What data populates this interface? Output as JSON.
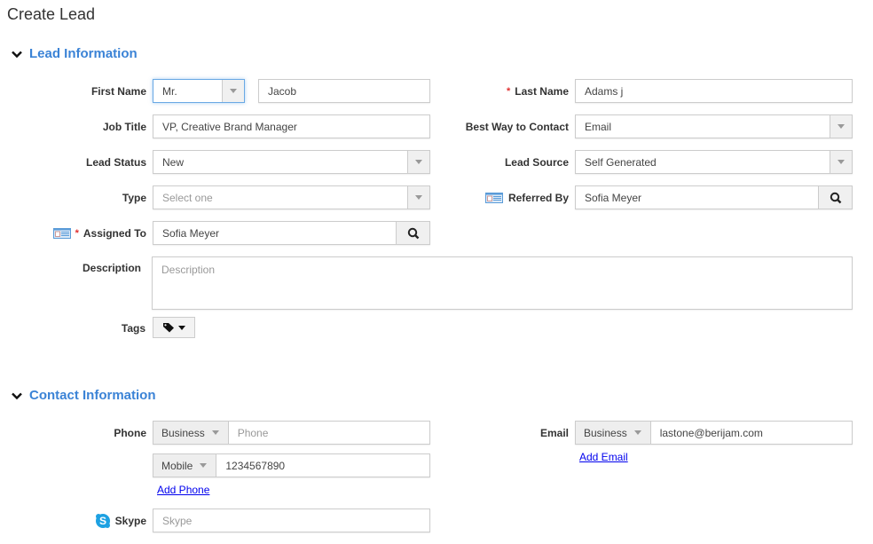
{
  "page": {
    "title": "Create Lead"
  },
  "sections": {
    "lead_info": {
      "title": "Lead Information",
      "fields": {
        "first_name": {
          "label": "First Name",
          "salutation": "Mr.",
          "value": "Jacob"
        },
        "last_name": {
          "label": "Last Name",
          "required_mark": "*",
          "value": "Adams j"
        },
        "job_title": {
          "label": "Job Title",
          "value": "VP, Creative Brand Manager"
        },
        "best_way": {
          "label": "Best Way to Contact",
          "value": "Email"
        },
        "lead_status": {
          "label": "Lead Status",
          "value": "New"
        },
        "lead_source": {
          "label": "Lead Source",
          "value": "Self Generated"
        },
        "type": {
          "label": "Type",
          "placeholder": "Select one"
        },
        "referred_by": {
          "label": "Referred By",
          "value": "Sofia Meyer"
        },
        "assigned_to": {
          "label": "Assigned To",
          "required_mark": "*",
          "value": "Sofia Meyer"
        },
        "description": {
          "label": "Description",
          "placeholder": "Description"
        },
        "tags": {
          "label": "Tags"
        }
      }
    },
    "contact_info": {
      "title": "Contact Information",
      "fields": {
        "phone": {
          "label": "Phone",
          "rows": [
            {
              "type": "Business",
              "placeholder": "Phone",
              "value": ""
            },
            {
              "type": "Mobile",
              "placeholder": "",
              "value": "1234567890"
            }
          ],
          "add_label": "Add Phone"
        },
        "email": {
          "label": "Email",
          "rows": [
            {
              "type": "Business",
              "value": "lastone@berijam.com"
            }
          ],
          "add_label": "Add Email"
        },
        "skype": {
          "label": "Skype",
          "placeholder": "Skype"
        }
      }
    }
  },
  "colors": {
    "accent": "#3b83d6",
    "required": "#e03030",
    "link": "#0000ee"
  }
}
